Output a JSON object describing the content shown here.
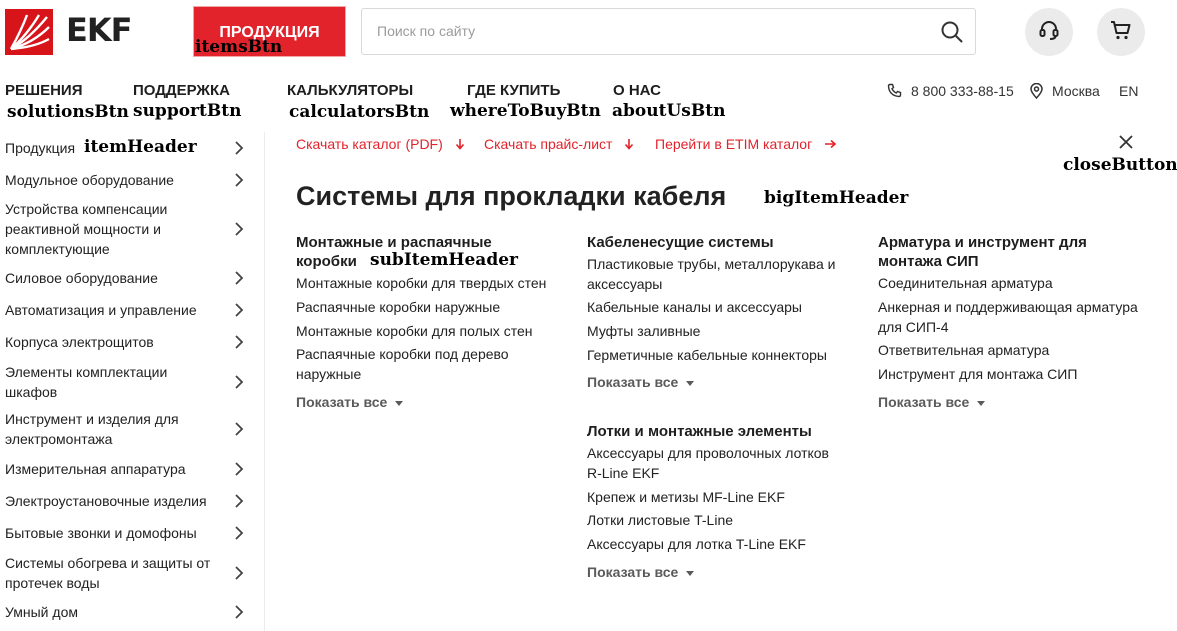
{
  "header": {
    "logo_text": "EKF",
    "products_button": "ПРОДУКЦИЯ",
    "search_placeholder": "Поиск по сайту"
  },
  "nav": {
    "solutions": "РЕШЕНИЯ",
    "support": "ПОДДЕРЖКА",
    "calculators": "КАЛЬКУЛЯТОРЫ",
    "where_to_buy": "ГДЕ КУПИТЬ",
    "about": "О НАС",
    "phone": "8 800 333-88-15",
    "city": "Москва",
    "language": "EN"
  },
  "annotations": {
    "items_btn": "itemsBtn",
    "solutions_btn": "solutionsBtn",
    "support_btn": "supportBtn",
    "calculators_btn": "calculatorsBtn",
    "where_to_buy_btn": "whereToBuyBtn",
    "about_us_btn": "aboutUsBtn",
    "item_header": "itemHeader",
    "close_button": "closeButton",
    "big_item_header": "bigItemHeader",
    "sub_item_header": "subItemHeader"
  },
  "sidebar": {
    "items": [
      "Продукция",
      "Модульное оборудование",
      "Устройства компенсации реактивной мощности и комплектующие",
      "Силовое оборудование",
      "Автоматизация и управление",
      "Корпуса электрощитов",
      "Элементы комплектации шкафов",
      "Инструмент и изделия для электромонтажа",
      "Измерительная аппаратура",
      "Электроустановочные изделия",
      "Бытовые звонки и домофоны",
      "Системы обогрева и защиты от протечек воды",
      "Умный дом"
    ]
  },
  "downloads": {
    "catalog": "Скачать каталог (PDF)",
    "price": "Скачать прайс-лист",
    "etim": "Перейти в ETIM каталог"
  },
  "main": {
    "title": "Системы для прокладки кабеля",
    "show_all": "Показать все",
    "groups": [
      {
        "title": "Монтажные и распаячные коробки",
        "links": [
          "Монтажные коробки для твердых стен",
          "Распаячные коробки наружные",
          "Монтажные коробки для полых стен",
          "Распаячные коробки под дерево наружные"
        ]
      },
      {
        "title": "Кабеленесущие системы",
        "links": [
          "Пластиковые трубы, металлорукава и аксессуары",
          "Кабельные каналы и аксессуары",
          "Муфты заливные",
          "Герметичные кабельные коннекторы"
        ]
      },
      {
        "title": "Арматура и инструмент для монтажа СИП",
        "links": [
          "Соединительная арматура",
          "Анкерная и поддерживающая арматура для СИП-4",
          "Ответвительная арматура",
          "Инструмент для монтажа СИП"
        ]
      },
      {
        "title": "Лотки и монтажные элементы",
        "links": [
          "Аксессуары для проволочных лотков R-Line EKF",
          "Крепеж и метизы MF-Line EKF",
          "Лотки листовые T-Line",
          "Аксессуары для лотка T-Line EKF"
        ]
      }
    ]
  },
  "colors": {
    "brand_red": "#e2232b",
    "text": "#1e1e1e",
    "muted": "#5a5a5a"
  },
  "icons": {
    "logo": "ekf-logo-icon",
    "search": "search-icon",
    "support": "headset-icon",
    "cart": "cart-icon",
    "phone": "phone-icon",
    "location": "location-pin-icon",
    "close": "close-icon",
    "chevron": "chevron-right-icon",
    "download": "arrow-down-icon",
    "external": "arrow-right-icon"
  }
}
